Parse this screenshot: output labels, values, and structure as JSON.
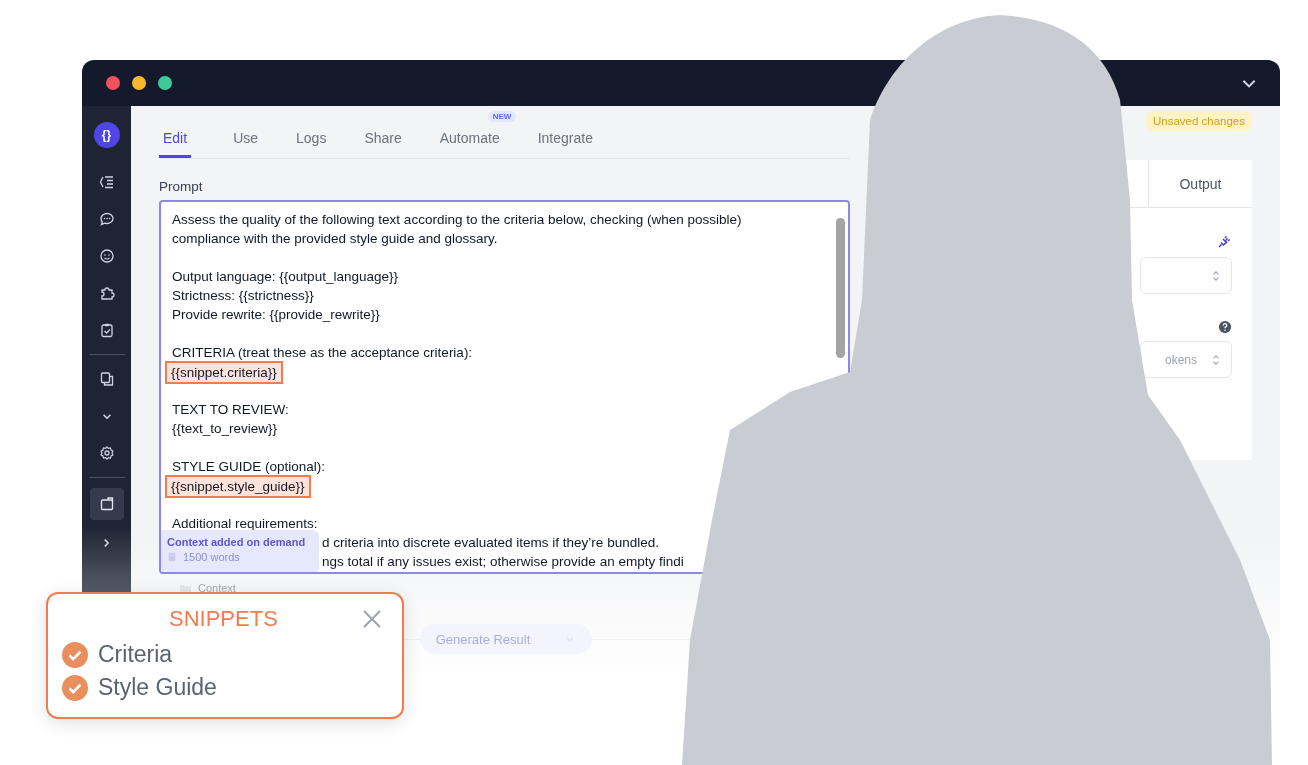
{
  "window": {
    "controls": [
      {
        "color": "#f0515a"
      },
      {
        "color": "#f5b82e"
      },
      {
        "color": "#3ec99a"
      }
    ]
  },
  "sidebar": {
    "logo": "{}",
    "items": [
      {
        "kind": "list",
        "selected": false
      },
      {
        "kind": "chat",
        "selected": false
      },
      {
        "kind": "smiley",
        "selected": false
      },
      {
        "kind": "puzzle",
        "selected": false
      },
      {
        "kind": "clipboard",
        "selected": false
      },
      {
        "kind": "divider"
      },
      {
        "kind": "copy",
        "selected": false
      },
      {
        "kind": "chevron-down",
        "selected": false
      },
      {
        "kind": "gear",
        "selected": false
      },
      {
        "kind": "divider"
      },
      {
        "kind": "panel",
        "selected": true
      },
      {
        "kind": "chevron-right",
        "selected": false
      }
    ]
  },
  "tabs": [
    {
      "label": "Edit",
      "selected": true
    },
    {
      "label": "Use",
      "selected": false
    },
    {
      "label": "Logs",
      "selected": false
    },
    {
      "label": "Share",
      "selected": false
    },
    {
      "label": "Automate",
      "selected": false,
      "badge": "NEW"
    },
    {
      "label": "Integrate",
      "selected": false
    }
  ],
  "status_badge": "Unsaved changes",
  "prompt": {
    "label": "Prompt",
    "lines": [
      {
        "kind": "text",
        "text": "Assess the quality of the following text according to the criteria below, checking (when possible)"
      },
      {
        "kind": "text",
        "text": "compliance with the provided style guide and glossary."
      },
      {
        "kind": "blank"
      },
      {
        "kind": "text",
        "text": "Output language: {{output_language}}"
      },
      {
        "kind": "text",
        "text": "Strictness: {{strictness}}"
      },
      {
        "kind": "text",
        "text": "Provide rewrite: {{provide_rewrite}}"
      },
      {
        "kind": "blank"
      },
      {
        "kind": "text",
        "text": "CRITERIA (treat these as the acceptance criteria):"
      },
      {
        "kind": "snippet",
        "text": "{{snippet.criteria}}"
      },
      {
        "kind": "blank"
      },
      {
        "kind": "text",
        "text": "TEXT TO REVIEW:"
      },
      {
        "kind": "text",
        "text": "{{text_to_review}}"
      },
      {
        "kind": "blank"
      },
      {
        "kind": "text",
        "text": "STYLE GUIDE (optional):"
      },
      {
        "kind": "snippet",
        "text": "{{snippet.style_guide}}"
      },
      {
        "kind": "blank"
      },
      {
        "kind": "text",
        "text": "Additional requirements:"
      },
      {
        "kind": "partial",
        "text": "d criteria into discrete evaluated items if they’re bundled."
      },
      {
        "kind": "partial",
        "text": "ngs total if any issues exist; otherwise provide an empty findi"
      }
    ]
  },
  "context_tooltip": {
    "title": "Context added on demand",
    "words": "1500 words"
  },
  "context_section": {
    "label": "Context"
  },
  "generate_button": {
    "label": "Generate Result"
  },
  "right_panel": {
    "tabs": [
      {
        "label": "Output"
      }
    ],
    "fields": [
      {
        "kind": "select"
      },
      {
        "kind": "select",
        "value": "okens"
      }
    ]
  },
  "snippets_popup": {
    "title": "SNIPPETS",
    "items": [
      {
        "label": "Criteria",
        "checked": true
      },
      {
        "label": "Style Guide",
        "checked": true
      }
    ]
  }
}
